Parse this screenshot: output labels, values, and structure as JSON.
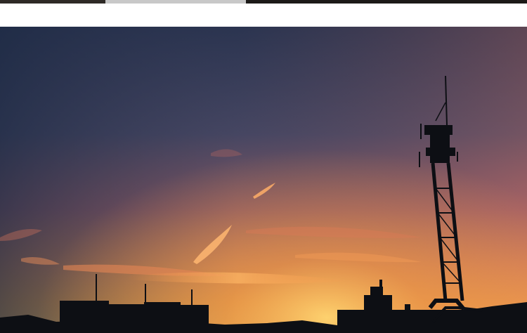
{
  "top_strip": {
    "colors": [
      "#2e2a26",
      "#3a3530",
      "#c8c8c8",
      "#1c1a18"
    ]
  },
  "photo": {
    "subject": "sunset-sky-with-tower-silhouette",
    "sky_colors": {
      "top_left": "#233047",
      "top_right": "#6a4a55",
      "mid": "#b46a57",
      "glow": "#f2a24a",
      "horizon": "#ffb347"
    },
    "silhouette_color": "#0d0f14"
  }
}
